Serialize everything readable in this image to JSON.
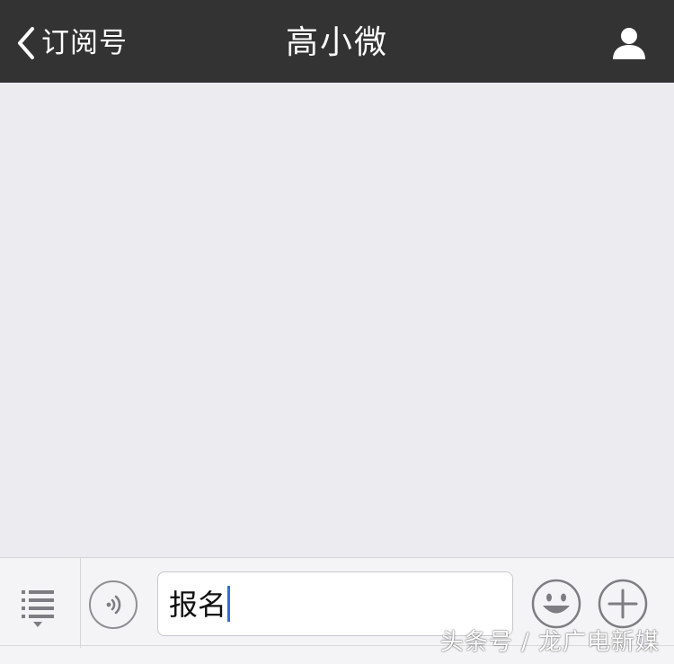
{
  "header": {
    "back_label": "订阅号",
    "title": "高小微"
  },
  "input": {
    "value": "报名"
  },
  "icons": {
    "back": "chevron-left-icon",
    "profile": "person-icon",
    "menu": "list-icon",
    "voice": "voice-icon",
    "emoji": "smiley-icon",
    "plus": "plus-icon"
  },
  "colors": {
    "header_bg": "#333334",
    "chat_bg": "#ebebf0",
    "caret": "#2f6fdb"
  },
  "watermark": "头条号 / 龙广电新媒"
}
